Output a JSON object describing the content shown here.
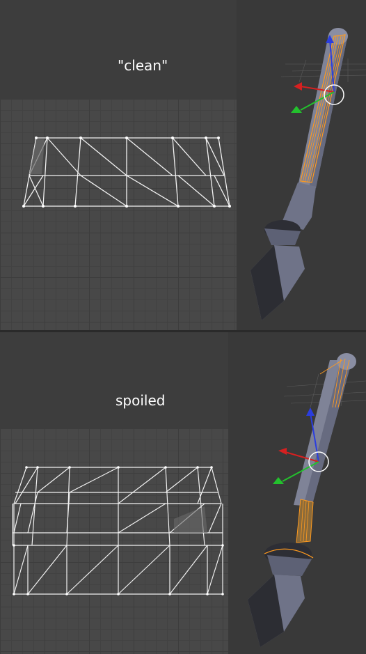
{
  "top": {
    "caption": "\"clean\""
  },
  "bottom": {
    "caption": "spoiled"
  },
  "colors": {
    "selection_orange": "#ff9a1e",
    "mesh_grey": "#7f8397",
    "axis_z": "#2a3de0",
    "axis_x": "#d62020",
    "axis_y": "#23c12d",
    "wire_white": "#f2f2f2"
  },
  "icons": [
    "transform-gizmo-icon",
    "pivot-circle-icon"
  ]
}
